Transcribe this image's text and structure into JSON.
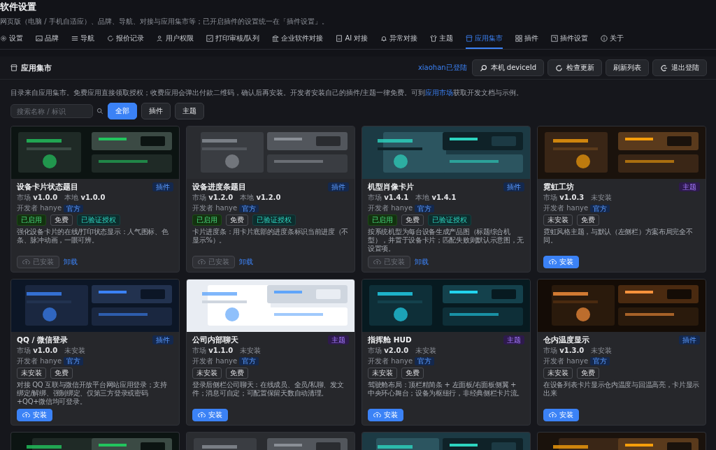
{
  "window": {
    "title": "软件设置",
    "subtitle": "网页版（电脑 / 手机自适应）、品牌、导航、对接与应用集市等；已开启插件的设置统一在「插件设置」。"
  },
  "tabs": [
    {
      "label": "设置",
      "selected": false
    },
    {
      "label": "品牌",
      "selected": false
    },
    {
      "label": "导航",
      "selected": false
    },
    {
      "label": "报价记录",
      "selected": false
    },
    {
      "label": "用户权限",
      "selected": false
    },
    {
      "label": "打印审核/队列",
      "selected": false
    },
    {
      "label": "企业软件对接",
      "selected": false
    },
    {
      "label": "AI 对接",
      "selected": false
    },
    {
      "label": "异常对接",
      "selected": false
    },
    {
      "label": "主题",
      "selected": false
    },
    {
      "label": "应用集市",
      "selected": true
    },
    {
      "label": "插件",
      "selected": false
    },
    {
      "label": "插件设置",
      "selected": false
    },
    {
      "label": "关于",
      "selected": false
    }
  ],
  "panel": {
    "title": "应用集市",
    "login_status": "xiaohan已登陆",
    "buttons": [
      {
        "label": "本机 deviceId",
        "kind": "search"
      },
      {
        "label": "检查更新",
        "kind": "refresh"
      },
      {
        "label": "刷新列表",
        "kind": "plain"
      },
      {
        "label": "退出登陆",
        "kind": "logout"
      }
    ],
    "info": {
      "before": "目录来自应用集市。免费应用直接领取授权；收费应用会弹出付款二维码，确认后再安装。开发者安装自己的插件/主题一律免费。可到",
      "link": "应用市场",
      "after": "获取开发文档与示例。"
    },
    "search": {
      "placeholder": "搜索名称 / 标识"
    },
    "filters": [
      {
        "label": "全部",
        "selected": true
      },
      {
        "label": "插件",
        "selected": false
      },
      {
        "label": "主题",
        "selected": false
      }
    ]
  },
  "cards": [
    {
      "title": "设备卡片状态题目",
      "badge": {
        "label": "插件",
        "kind": "plugin"
      },
      "meta": "市场 **v1.0.0**　本地 **v1.0.0**",
      "developer": "开发者 hanye",
      "official": "官方",
      "tags": [
        {
          "label": "已启用",
          "kind": "enabled"
        },
        {
          "label": "免费",
          "kind": "plain"
        },
        {
          "label": "已验证授权",
          "kind": "verified"
        }
      ],
      "description": "强化设备卡片的在线/打印状态显示：人气图标、色条、脉冲动画，一眼可辨。",
      "action": {
        "kind": "installed",
        "label": "已安装"
      },
      "link": "卸载"
    },
    {
      "title": "设备进度条题目",
      "badge": {
        "label": "插件",
        "kind": "plugin"
      },
      "meta": "市场 **v1.2.0**　本地 **v1.2.0**",
      "developer": "开发者 hanye",
      "official": "官方",
      "tags": [
        {
          "label": "已启用",
          "kind": "enabled"
        },
        {
          "label": "免费",
          "kind": "plain"
        },
        {
          "label": "已验证授权",
          "kind": "verified"
        }
      ],
      "description": "卡片进度条：用卡片底部的进度条标识当前进度（不显示%）。",
      "action": {
        "kind": "installed",
        "label": "已安装"
      },
      "link": "卸载"
    },
    {
      "title": "机型肖像卡片",
      "badge": {
        "label": "插件",
        "kind": "plugin"
      },
      "meta": "市场 **v1.4.1**　本地 **v1.4.1**",
      "developer": "开发者 hanye",
      "official": "官方",
      "tags": [
        {
          "label": "已启用",
          "kind": "enabled"
        },
        {
          "label": "免费",
          "kind": "plain"
        },
        {
          "label": "已验证授权",
          "kind": "verified"
        }
      ],
      "description": "按系统机型为每台设备生成产品图（标题综合机型），并置于设备卡片；匹配失败则默认示意图，无设置项。",
      "action": {
        "kind": "installed",
        "label": "已安装"
      },
      "link": "卸载"
    },
    {
      "title": "霓虹工坊",
      "badge": {
        "label": "主题",
        "kind": "theme"
      },
      "meta": "市场 **v1.0.3**　未安装",
      "developer": "开发者 hanye",
      "official": "官方",
      "tags": [
        {
          "label": "未安装",
          "kind": "plain"
        },
        {
          "label": "免费",
          "kind": "plain"
        }
      ],
      "description": "霓虹风格主题，与默认（左侧栏）方案布局完全不同。",
      "action": {
        "kind": "install",
        "label": "安装"
      }
    },
    {
      "title": "QQ / 微信登录",
      "badge": {
        "label": "插件",
        "kind": "plugin"
      },
      "meta": "市场 **v1.0.0**　未安装",
      "developer": "开发者 hanye",
      "official": "官方",
      "tags": [
        {
          "label": "未安装",
          "kind": "plain"
        },
        {
          "label": "免费",
          "kind": "plain"
        }
      ],
      "description": "对接 QQ 互联与微信开放平台网站应用登录；支持绑定/解绑、强制绑定、仅第三方登录或密码+QQ+微信均可登录。",
      "action": {
        "kind": "install",
        "label": "安装"
      }
    },
    {
      "title": "公司内部聊天",
      "badge": {
        "label": "主题",
        "kind": "theme"
      },
      "meta": "市场 **v1.1.0**　未安装",
      "developer": "开发者 hanye",
      "official": "官方",
      "tags": [
        {
          "label": "未安装",
          "kind": "plain"
        },
        {
          "label": "免费",
          "kind": "plain"
        }
      ],
      "description": "登录后侧栏公司聊天：在线成员、全员/私聊、发文件；消息可自定；可配置保留天数自动清理。",
      "action": {
        "kind": "install",
        "label": "安装"
      }
    },
    {
      "title": "指挥舱 HUD",
      "badge": {
        "label": "主题",
        "kind": "theme"
      },
      "meta": "市场 **v2.0.0**　未安装",
      "developer": "开发者 hanye",
      "official": "官方",
      "tags": [
        {
          "label": "未安装",
          "kind": "plain"
        },
        {
          "label": "免费",
          "kind": "plain"
        }
      ],
      "description": "驾驶舱布局：顶栏精简条 + 左面板/右面板侧翼 + 中央环心舞台；设备为枢纽行，非经典侧栏卡片流。",
      "action": {
        "kind": "install",
        "label": "安装"
      }
    },
    {
      "title": "仓内温度显示",
      "badge": {
        "label": "插件",
        "kind": "plugin"
      },
      "meta": "市场 **v1.3.0**　未安装",
      "developer": "开发者 hanye",
      "official": "官方",
      "tags": [
        {
          "label": "未安装",
          "kind": "plain"
        },
        {
          "label": "免费",
          "kind": "plain"
        }
      ],
      "description": "在设备列表卡片显示仓内温度与回温高亮，卡片显示出来",
      "action": {
        "kind": "install",
        "label": "安装"
      }
    },
    {
      "kind": "picture"
    },
    {
      "kind": "picture"
    },
    {
      "kind": "picture"
    },
    {
      "kind": "picture"
    }
  ]
}
